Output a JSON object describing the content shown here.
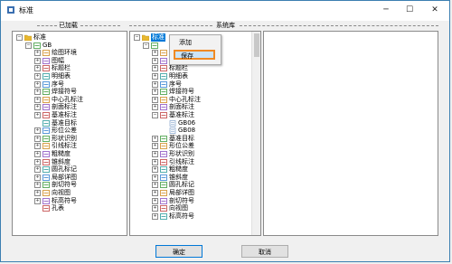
{
  "window": {
    "title": "标准",
    "minimize": "─",
    "maximize": "☐",
    "close": "✕"
  },
  "groups": {
    "added": "已加载",
    "system": "系统库"
  },
  "left_tree": [
    {
      "label": "标准",
      "icon": "folder-icon",
      "level": 0,
      "expander": "-"
    },
    {
      "label": "GB",
      "icon": "standard-icon",
      "level": 1,
      "expander": "-"
    },
    {
      "label": "绘图环境",
      "icon": "env-icon",
      "level": 2,
      "expander": "+"
    },
    {
      "label": "图幅",
      "icon": "frame-icon",
      "level": 2,
      "expander": "+"
    },
    {
      "label": "标题栏",
      "icon": "title-block-icon",
      "level": 2,
      "expander": "+"
    },
    {
      "label": "明细表",
      "icon": "bom-icon",
      "level": 2,
      "expander": "+"
    },
    {
      "label": "序号",
      "icon": "balloon-icon",
      "level": 2,
      "expander": "+"
    },
    {
      "label": "焊接符号",
      "icon": "weld-icon",
      "level": 2,
      "expander": "+"
    },
    {
      "label": "中心孔标注",
      "icon": "center-hole-icon",
      "level": 2,
      "expander": "+"
    },
    {
      "label": "剖面标注",
      "icon": "section-icon",
      "level": 2,
      "expander": "+"
    },
    {
      "label": "基准标注",
      "icon": "datum-icon",
      "level": 2,
      "expander": "+"
    },
    {
      "label": "基准目标",
      "icon": "datum-target-icon",
      "level": 2,
      "expander": ""
    },
    {
      "label": "形位公差",
      "icon": "tolerance-icon",
      "level": 2,
      "expander": "+"
    },
    {
      "label": "形状识别",
      "icon": "shape-icon",
      "level": 2,
      "expander": "+"
    },
    {
      "label": "引线标注",
      "icon": "leader-icon",
      "level": 2,
      "expander": "+"
    },
    {
      "label": "粗糙度",
      "icon": "roughness-icon",
      "level": 2,
      "expander": "+"
    },
    {
      "label": "锥斜度",
      "icon": "taper-icon",
      "level": 2,
      "expander": "+"
    },
    {
      "label": "圆孔标记",
      "icon": "hole-icon",
      "level": 2,
      "expander": "+"
    },
    {
      "label": "局部详图",
      "icon": "detail-icon",
      "level": 2,
      "expander": "+"
    },
    {
      "label": "剖切符号",
      "icon": "cut-icon",
      "level": 2,
      "expander": "+"
    },
    {
      "label": "向视图",
      "icon": "view-icon",
      "level": 2,
      "expander": "+"
    },
    {
      "label": "标高符号",
      "icon": "elevation-icon",
      "level": 2,
      "expander": "+"
    },
    {
      "label": "孔表",
      "icon": "hole-table-icon",
      "level": 2,
      "expander": ""
    }
  ],
  "mid_tree": [
    {
      "label": "标准",
      "icon": "folder-icon",
      "level": 0,
      "expander": "-",
      "selected": true
    },
    {
      "label": "",
      "icon": "standard-icon",
      "level": 1,
      "expander": "-"
    },
    {
      "label": "",
      "icon": "env-icon",
      "level": 2,
      "expander": "+"
    },
    {
      "label": "图幅",
      "icon": "frame-icon",
      "level": 2,
      "expander": "+"
    },
    {
      "label": "标题栏",
      "icon": "title-block-icon",
      "level": 2,
      "expander": "+"
    },
    {
      "label": "明细表",
      "icon": "bom-icon",
      "level": 2,
      "expander": "+"
    },
    {
      "label": "序号",
      "icon": "balloon-icon",
      "level": 2,
      "expander": "+"
    },
    {
      "label": "焊接符号",
      "icon": "weld-icon",
      "level": 2,
      "expander": "+"
    },
    {
      "label": "中心孔标注",
      "icon": "center-hole-icon",
      "level": 2,
      "expander": "+"
    },
    {
      "label": "剖面标注",
      "icon": "section-icon",
      "level": 2,
      "expander": "+"
    },
    {
      "label": "基准标注",
      "icon": "datum-icon",
      "level": 2,
      "expander": "-"
    },
    {
      "label": "GB06",
      "icon": "doc-icon",
      "level": 3,
      "expander": ""
    },
    {
      "label": "GB08",
      "icon": "doc-icon",
      "level": 3,
      "expander": ""
    },
    {
      "label": "基准目标",
      "icon": "datum-target-icon",
      "level": 2,
      "expander": "+"
    },
    {
      "label": "形位公差",
      "icon": "tolerance-icon",
      "level": 2,
      "expander": "+"
    },
    {
      "label": "形状识别",
      "icon": "shape-icon",
      "level": 2,
      "expander": "+"
    },
    {
      "label": "引线标注",
      "icon": "leader-icon",
      "level": 2,
      "expander": "+"
    },
    {
      "label": "粗糙度",
      "icon": "roughness-icon",
      "level": 2,
      "expander": "+"
    },
    {
      "label": "锥斜度",
      "icon": "taper-icon",
      "level": 2,
      "expander": "+"
    },
    {
      "label": "圆孔标记",
      "icon": "hole-icon",
      "level": 2,
      "expander": "+"
    },
    {
      "label": "局部详图",
      "icon": "detail-icon",
      "level": 2,
      "expander": "+"
    },
    {
      "label": "剖切符号",
      "icon": "cut-icon",
      "level": 2,
      "expander": "+"
    },
    {
      "label": "向视图",
      "icon": "view-icon",
      "level": 2,
      "expander": "+"
    },
    {
      "label": "标高符号",
      "icon": "elevation-icon",
      "level": 2,
      "expander": "+"
    }
  ],
  "context_menu": {
    "items": [
      "添加",
      "保存"
    ],
    "highlighted": "保存"
  },
  "buttons": {
    "ok": "确定",
    "cancel": "取消"
  },
  "colors": {
    "accent": "#0078d7",
    "highlight_border": "#f08a24",
    "selection": "#0078d7"
  }
}
